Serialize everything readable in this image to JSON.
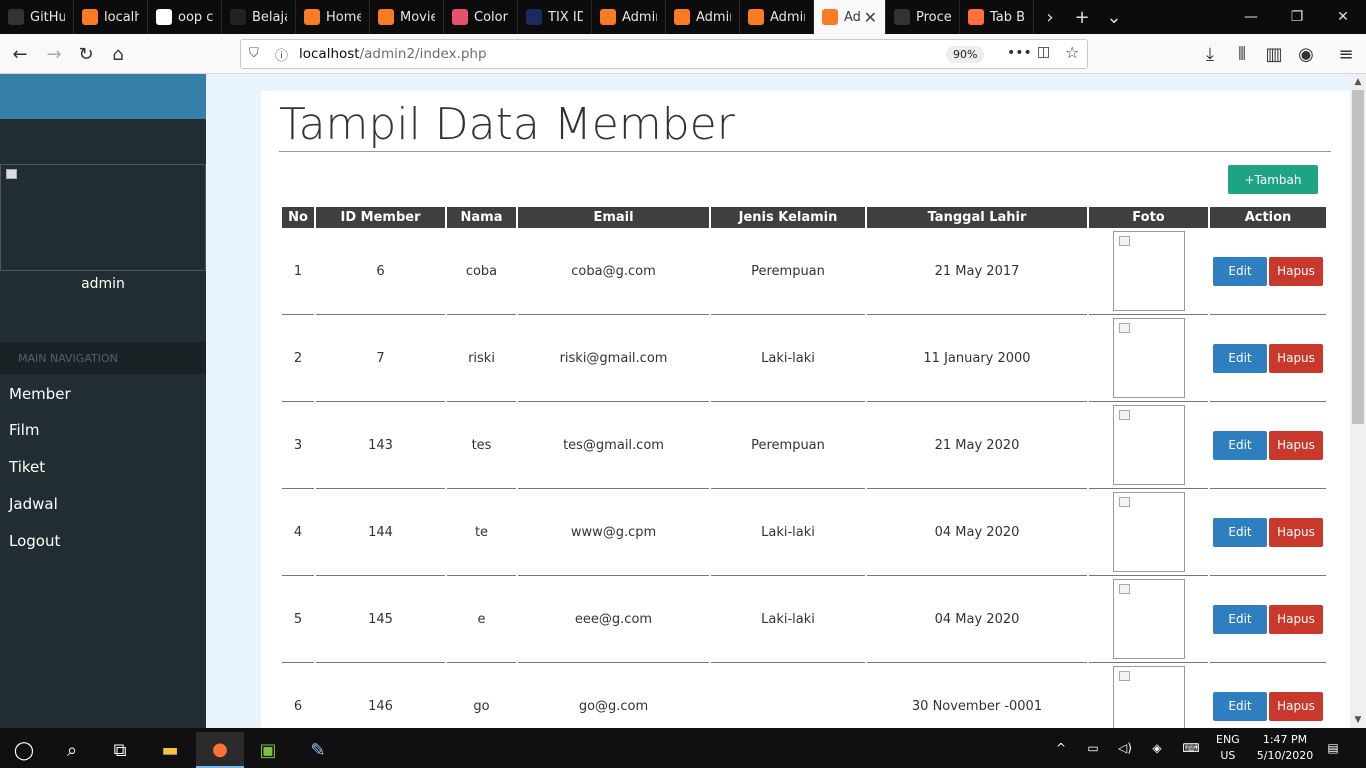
{
  "browser": {
    "tabs": [
      {
        "label": "GitHub",
        "icon": "github-icon",
        "color": "#333333"
      },
      {
        "label": "localhost",
        "icon": "xampp-icon",
        "color": "#fb7a24"
      },
      {
        "label": "oop cr",
        "icon": "google-icon",
        "color": "#ffffff"
      },
      {
        "label": "Belajar",
        "icon": "codepolitan-icon",
        "color": "#222222"
      },
      {
        "label": "Home",
        "icon": "xampp-icon",
        "color": "#fb7a24"
      },
      {
        "label": "Movie",
        "icon": "xampp-icon",
        "color": "#fb7a24"
      },
      {
        "label": "Color",
        "icon": "color-icon",
        "color": "#e8506b"
      },
      {
        "label": "TIX ID",
        "icon": "tixid-icon",
        "color": "#1a2c5b"
      },
      {
        "label": "Admin",
        "icon": "xampp-icon",
        "color": "#fb7a24"
      },
      {
        "label": "Admin",
        "icon": "xampp-icon",
        "color": "#fb7a24"
      },
      {
        "label": "Admin",
        "icon": "xampp-icon",
        "color": "#fb7a24"
      },
      {
        "label": "Ad",
        "icon": "xampp-icon",
        "color": "#fb7a24",
        "active": true
      },
      {
        "label": "Proces",
        "icon": "blank-icon",
        "color": "#333333"
      },
      {
        "label": "Tab Ba",
        "icon": "firefox-icon",
        "color": "#ff7139"
      }
    ],
    "url_host": "localhost",
    "url_path": "/admin2/index.php",
    "zoom": "90%"
  },
  "sidebar": {
    "username": "admin",
    "nav_header": "MAIN NAVIGATION",
    "items": [
      "Member",
      "Film",
      "Tiket",
      "Jadwal",
      "Logout"
    ]
  },
  "main": {
    "title": "Tampil Data Member",
    "add_button": "+Tambah",
    "columns": [
      "No",
      "ID Member",
      "Nama",
      "Email",
      "Jenis Kelamin",
      "Tanggal Lahir",
      "Foto",
      "Action"
    ],
    "rows": [
      {
        "no": "1",
        "id": "6",
        "nama": "coba",
        "email": "coba@g.com",
        "jk": "Perempuan",
        "tgl": "21 May 2017"
      },
      {
        "no": "2",
        "id": "7",
        "nama": "riski",
        "email": "riski@gmail.com",
        "jk": "Laki-laki",
        "tgl": "11 January 2000"
      },
      {
        "no": "3",
        "id": "143",
        "nama": "tes",
        "email": "tes@gmail.com",
        "jk": "Perempuan",
        "tgl": "21 May 2020"
      },
      {
        "no": "4",
        "id": "144",
        "nama": "te",
        "email": "www@g.cpm",
        "jk": "Laki-laki",
        "tgl": "04 May 2020"
      },
      {
        "no": "5",
        "id": "145",
        "nama": "e",
        "email": "eee@g.com",
        "jk": "Laki-laki",
        "tgl": "04 May 2020"
      },
      {
        "no": "6",
        "id": "146",
        "nama": "go",
        "email": "go@g.com",
        "jk": "",
        "tgl": "30 November -0001"
      }
    ],
    "edit_label": "Edit",
    "hapus_label": "Hapus"
  },
  "taskbar": {
    "lang_top": "ENG",
    "lang_bottom": "US",
    "time": "1:47 PM",
    "date": "5/10/2020"
  },
  "colors": {
    "sidebar_bg": "#222d32",
    "sidebar_top": "#367fa9",
    "tambah": "#1fa385",
    "edit": "#2f7ebf",
    "hapus": "#c9392b",
    "table_header": "#3f3f3f"
  }
}
